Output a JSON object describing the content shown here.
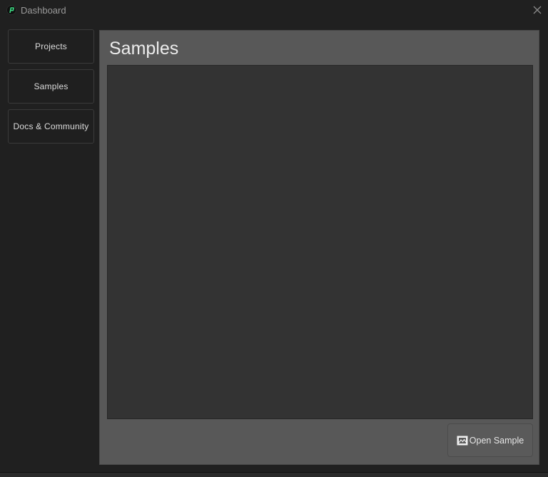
{
  "window": {
    "title": "Dashboard",
    "icons": {
      "app": "app-logo-icon",
      "close": "close-icon",
      "open_sample": "chart-image-icon"
    }
  },
  "sidebar": {
    "items": [
      {
        "label": "Projects"
      },
      {
        "label": "Samples"
      },
      {
        "label": "Docs & Community"
      }
    ]
  },
  "main": {
    "title": "Samples",
    "open_sample_label": "Open Sample"
  },
  "colors": {
    "accent": "#3ddc84",
    "window_bg": "#202020",
    "panel_bg": "#585858",
    "list_bg": "#333333"
  }
}
